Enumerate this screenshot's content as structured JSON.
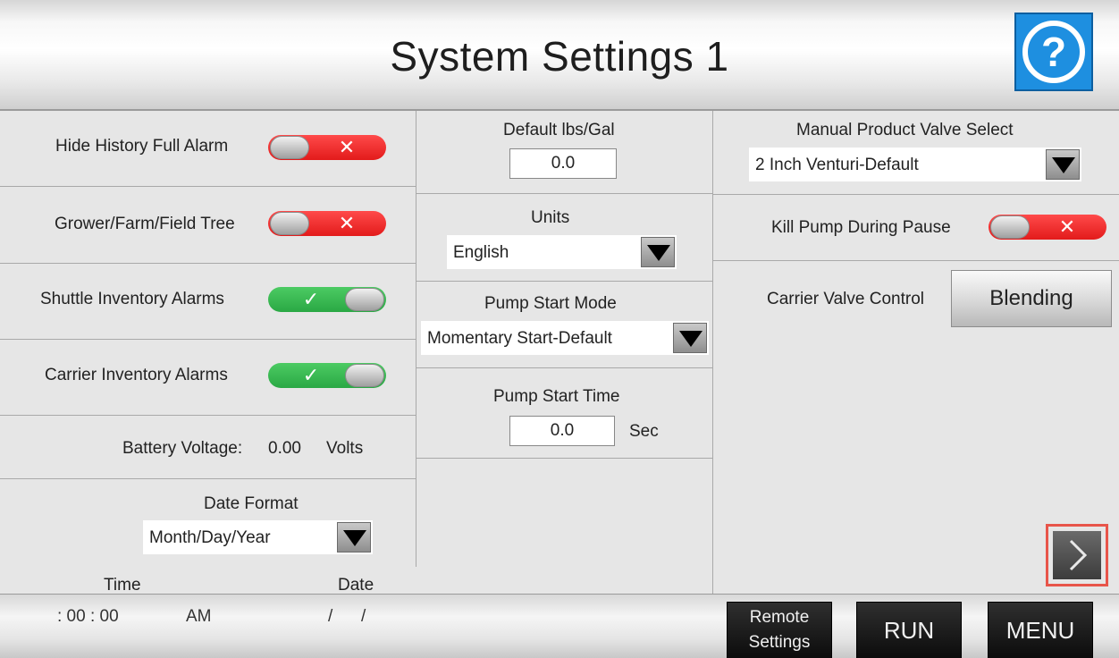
{
  "header": {
    "title": "System Settings 1",
    "help_glyph": "?"
  },
  "left": {
    "hide_history_label": "Hide History Full Alarm",
    "hide_history_mark": "✕",
    "grower_tree_label": "Grower/Farm/Field Tree",
    "grower_tree_mark": "✕",
    "shuttle_inv_label": "Shuttle Inventory Alarms",
    "shuttle_inv_mark": "✓",
    "carrier_inv_label": "Carrier Inventory Alarms",
    "carrier_inv_mark": "✓",
    "battery_label": "Battery Voltage:",
    "battery_value": "0.00",
    "battery_unit": "Volts",
    "date_format_label": "Date Format",
    "date_format_value": "Month/Day/Year"
  },
  "middle": {
    "default_lbs_label": "Default lbs/Gal",
    "default_lbs_value": "0.0",
    "units_label": "Units",
    "units_value": "English",
    "pump_start_mode_label": "Pump Start Mode",
    "pump_start_mode_value": "Momentary Start-Default",
    "pump_start_time_label": "Pump Start Time",
    "pump_start_time_value": "0.0",
    "pump_start_time_unit": "Sec"
  },
  "right": {
    "manual_valve_label": "Manual Product Valve Select",
    "manual_valve_value": "2 Inch Venturi-Default",
    "kill_pump_label": "Kill Pump During Pause",
    "kill_pump_mark": "✕",
    "carrier_valve_label": "Carrier Valve Control",
    "carrier_valve_value": "Blending"
  },
  "toggles": {
    "hide_history": false,
    "grower_tree": false,
    "shuttle_inventory": true,
    "carrier_inventory": true,
    "kill_pump": false
  },
  "clock": {
    "time_label": "Time",
    "date_label": "Date",
    "time_value": ":  00  :  00",
    "ampm": "AM",
    "date_sep1": "/",
    "date_sep2": "/"
  },
  "footer": {
    "remote_line1": "Remote",
    "remote_line2": "Settings",
    "run_label": "RUN",
    "menu_label": "MENU"
  },
  "icons": {
    "help": "question-circle-icon",
    "dropdown": "triangle-down-icon",
    "next": "chevron-right-icon",
    "annotation": "red-arrow-annotation"
  },
  "colors": {
    "toggle_off": "#e31b1b",
    "toggle_on": "#2aa844",
    "help_blue": "#1e8fe0",
    "annotation_red": "#e8554a"
  }
}
